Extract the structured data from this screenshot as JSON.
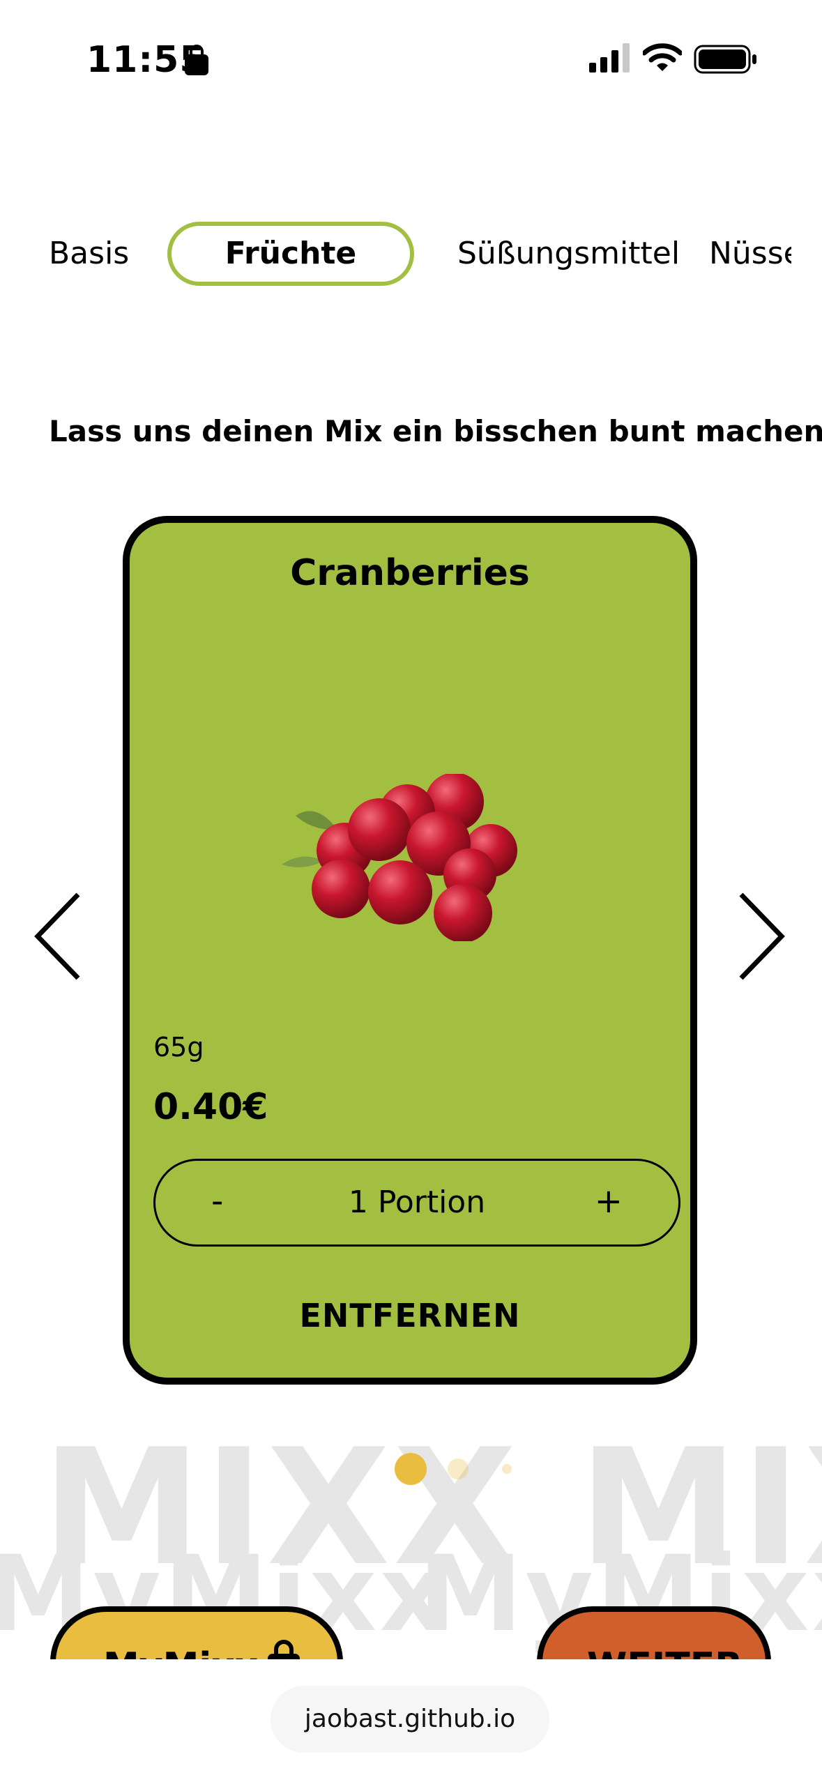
{
  "status_bar": {
    "time": "11:55"
  },
  "tabs": [
    {
      "label": "Basis"
    },
    {
      "label": "Früchte",
      "active": true
    },
    {
      "label": "Süßungsmittel"
    },
    {
      "label": "Nüsse"
    }
  ],
  "headline": "Lass uns deinen Mix ein bisschen bunt machen!",
  "card": {
    "title": "Cranberries",
    "weight": "65g",
    "price": "0.40€",
    "quantity_label": "1 Portion",
    "decrement_label": "-",
    "increment_label": "+",
    "remove_label": "ENTFERNEN",
    "background_color": "#a3bf42"
  },
  "pagination": {
    "count": 3,
    "active_index": 0
  },
  "watermark": {
    "text": "MIXX",
    "text2": "MyMixx"
  },
  "buttons": {
    "mymixx_label": "MyMixx",
    "weiter_label": "WEITER"
  },
  "browser": {
    "url": "jaobast.github.io"
  },
  "colors": {
    "accent_green": "#a3bf42",
    "yellow": "#e9bd40",
    "orange": "#d05f2b"
  }
}
